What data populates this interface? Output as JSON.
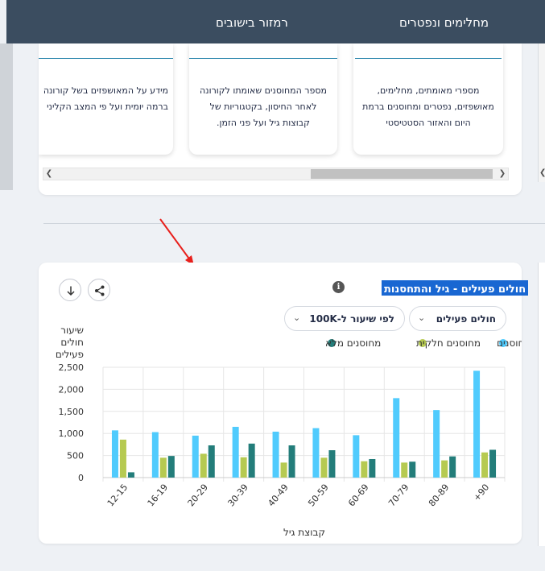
{
  "nav": {
    "item_1": "מחלימים ונפטרים",
    "item_2": "רמזור בישובים"
  },
  "info_cards": [
    {
      "text": "מספרי מאומתים, מחלימים, מאושפזים, נפטרים ומחוסנים ברמת היום והאזור הסטטיסטי"
    },
    {
      "text": "מספר המחוסנים שאומתו לקורונה לאחר החיסון, בקטגוריות של קבוצות גיל ועל פני הזמן."
    },
    {
      "line_1": "מידע על המאושפזים בשל קורונה",
      "line_2": "ברמה יומית ועל פי המצב הקליני"
    }
  ],
  "card": {
    "title": "חולים פעילים - גיל והתחסנות",
    "info_glyph": "i",
    "select_active": "חולים פעילים",
    "select_rate": "לפי שיעור ל-100K"
  },
  "icons": {
    "info": "info-icon",
    "share": "share-icon",
    "download": "download-icon",
    "chevron": "chevron-down-icon"
  },
  "colors": {
    "nav_bg": "#3b4d60",
    "title_highlight": "#1967d2",
    "series_unvaccinated": "#50cbfd",
    "series_partial": "#b6ca51",
    "series_full": "#237d7a",
    "annotation_arrow": "#e8201c"
  },
  "chart_data": {
    "type": "bar",
    "ylabel_lines": [
      "שיעור",
      "חולים",
      "פעילים"
    ],
    "xlabel": "קבוצת גיל",
    "ylim": [
      0,
      2500
    ],
    "yticks": [
      0,
      500,
      1000,
      1500,
      2000,
      2500
    ],
    "ytick_labels": [
      "0",
      "500",
      "1,000",
      "1,500",
      "2,000",
      "2,500"
    ],
    "grid": true,
    "legend_position": "top-right",
    "categories": [
      "12-15",
      "16-19",
      "20-29",
      "30-39",
      "40-49",
      "50-59",
      "60-69",
      "70-79",
      "80-89",
      "+90"
    ],
    "series": [
      {
        "name": "לא מחוסנים",
        "color": "#50cbfd",
        "values": [
          1070,
          1030,
          950,
          1150,
          1040,
          1120,
          960,
          1800,
          1530,
          2420
        ]
      },
      {
        "name": "מחוסנים חלקית",
        "color": "#b6ca51",
        "values": [
          860,
          450,
          540,
          460,
          340,
          450,
          370,
          340,
          390,
          570
        ]
      },
      {
        "name": "מחוסנים מלא",
        "color": "#237d7a",
        "values": [
          120,
          490,
          730,
          770,
          730,
          620,
          420,
          360,
          480,
          630
        ]
      }
    ]
  }
}
